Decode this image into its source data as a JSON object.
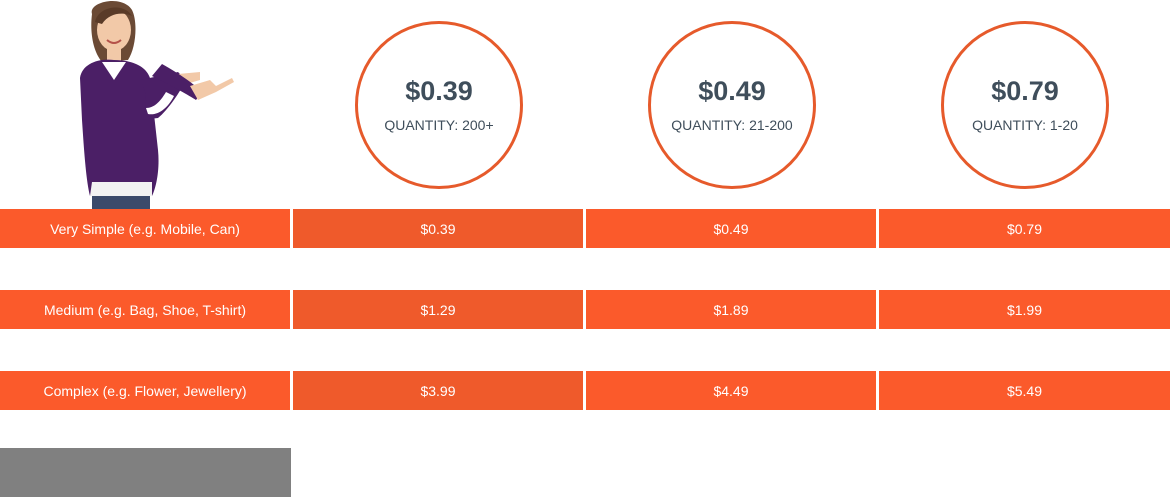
{
  "tiers": [
    {
      "price": "$0.39",
      "quantity": "QUANTITY: 200+"
    },
    {
      "price": "$0.49",
      "quantity": "QUANTITY: 21-200"
    },
    {
      "price": "$0.79",
      "quantity": "QUANTITY: 1-20"
    }
  ],
  "rows": [
    {
      "label": "Very Simple (e.g. Mobile, Can)",
      "prices": [
        "$0.39",
        "$0.49",
        "$0.79"
      ]
    },
    {
      "label": "Medium (e.g. Bag, Shoe, T-shirt)",
      "prices": [
        "$1.29",
        "$1.89",
        "$1.99"
      ]
    },
    {
      "label": "Complex (e.g. Flower, Jewellery)",
      "prices": [
        "$3.99",
        "$4.49",
        "$5.49"
      ]
    }
  ],
  "colors": {
    "accent": "#fb5a2b",
    "circle_border": "#e65a2b",
    "price_text": "#3f4e5b",
    "footer_box": "#808080"
  },
  "illustration": {
    "subject": "woman-pointing-right"
  }
}
